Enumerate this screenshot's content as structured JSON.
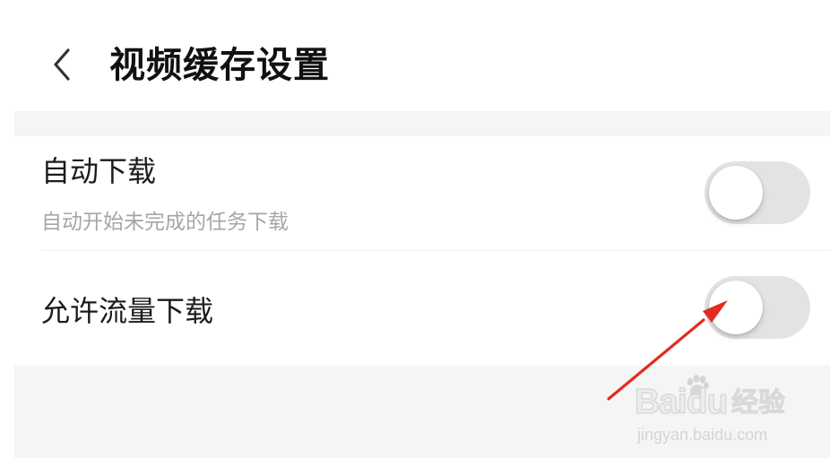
{
  "header": {
    "title": "视频缓存设置",
    "back_icon": "chevron-left-icon"
  },
  "settings": {
    "auto_download": {
      "title": "自动下载",
      "subtitle": "自动开始未完成的任务下载",
      "enabled": false
    },
    "allow_traffic_download": {
      "title": "允许流量下载",
      "enabled": false
    }
  },
  "watermark": {
    "brand": "Baidu",
    "brand_cn": "经验",
    "url": "jingyan.baidu.com"
  },
  "annotation": {
    "arrow_color": "#e02b21",
    "points_to": "allow_traffic_download toggle"
  },
  "colors": {
    "background": "#ffffff",
    "section_gap": "#f5f5f6",
    "primary_text": "#1b1b1b",
    "secondary_text": "#a6a6a6",
    "toggle_off_track": "#e3e3e3",
    "toggle_knob": "#ffffff"
  }
}
